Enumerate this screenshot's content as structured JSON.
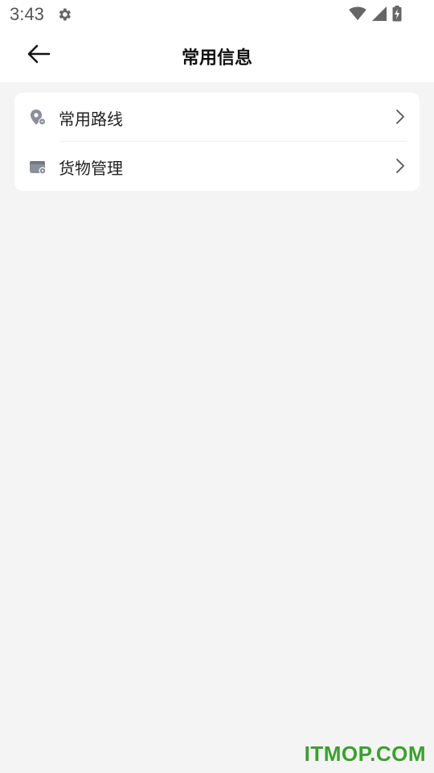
{
  "status_bar": {
    "time": "3:43",
    "icons": [
      "settings-icon",
      "wifi-icon",
      "signal-icon",
      "battery-charging-icon"
    ]
  },
  "app_bar": {
    "title": "常用信息",
    "back_icon": "arrow-left-icon"
  },
  "menu": {
    "items": [
      {
        "label": "常用路线",
        "icon": "route-pin-icon"
      },
      {
        "label": "货物管理",
        "icon": "cargo-box-icon"
      }
    ]
  },
  "watermark": "ITMOP.COM",
  "colors": {
    "background": "#f4f4f4",
    "card": "#ffffff",
    "icon_gray": "#8a8f99",
    "watermark_green": "#3aa02e"
  }
}
